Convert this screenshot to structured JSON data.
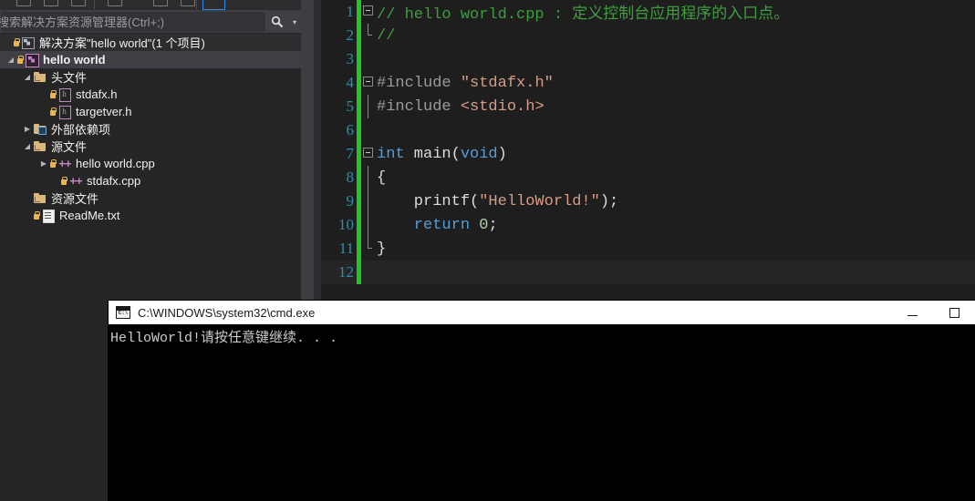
{
  "solution_explorer": {
    "search": {
      "placeholder": "搜索解决方案资源管理器(Ctrl+;)",
      "icon": "search-icon",
      "caret": "▾"
    },
    "toolbar": {
      "separator": "",
      "active_button": ""
    },
    "tree": [
      {
        "label": "解决方案\"hello world\"(1 个项目)",
        "indent": 2,
        "twisty": "",
        "icon": "solution-icon",
        "lock": true,
        "bold": false,
        "selected": false,
        "solution_row": true
      },
      {
        "label": "hello world",
        "indent": 6,
        "twisty": "▲",
        "icon": "project-icon",
        "lock": true,
        "bold": true,
        "selected": true,
        "solution_row": false
      },
      {
        "label": "头文件",
        "indent": 24,
        "twisty": "▲",
        "icon": "folder-icon",
        "lock": false,
        "bold": false,
        "selected": false,
        "solution_row": false
      },
      {
        "label": "stdafx.h",
        "indent": 42,
        "twisty": "",
        "icon": "header-file-icon",
        "lock": true,
        "bold": false,
        "selected": false,
        "solution_row": false
      },
      {
        "label": "targetver.h",
        "indent": 42,
        "twisty": "",
        "icon": "header-file-icon",
        "lock": true,
        "bold": false,
        "selected": false,
        "solution_row": false
      },
      {
        "label": "外部依赖项",
        "indent": 24,
        "twisty": "▶",
        "icon": "folder-box-icon",
        "lock": false,
        "bold": false,
        "selected": false,
        "solution_row": false
      },
      {
        "label": "源文件",
        "indent": 24,
        "twisty": "▲",
        "icon": "folder-icon",
        "lock": false,
        "bold": false,
        "selected": false,
        "solution_row": false
      },
      {
        "label": "hello world.cpp",
        "indent": 42,
        "twisty": "▶",
        "icon": "cpp-file-icon",
        "lock": true,
        "bold": false,
        "selected": false,
        "solution_row": false
      },
      {
        "label": "stdafx.cpp",
        "indent": 54,
        "twisty": "",
        "icon": "cpp-file-icon",
        "lock": true,
        "bold": false,
        "selected": false,
        "solution_row": false
      },
      {
        "label": "资源文件",
        "indent": 24,
        "twisty": "",
        "icon": "folder-icon",
        "lock": false,
        "bold": false,
        "selected": false,
        "solution_row": false
      },
      {
        "label": "ReadMe.txt",
        "indent": 24,
        "twisty": "",
        "icon": "text-file-icon",
        "lock": true,
        "bold": false,
        "selected": false,
        "solution_row": false
      }
    ]
  },
  "editor": {
    "lines": [
      {
        "num": "1",
        "outline": "box",
        "current": false,
        "tokens": [
          {
            "t": "comment",
            "v": "// hello world.cpp : 定义控制台应用程序的入口点。"
          }
        ]
      },
      {
        "num": "2",
        "outline": "end",
        "current": false,
        "tokens": [
          {
            "t": "comment",
            "v": "//"
          }
        ]
      },
      {
        "num": "3",
        "outline": "none",
        "current": false,
        "tokens": []
      },
      {
        "num": "4",
        "outline": "box",
        "current": false,
        "tokens": [
          {
            "t": "pre",
            "v": "#include "
          },
          {
            "t": "str",
            "v": "\"stdafx.h\""
          }
        ]
      },
      {
        "num": "5",
        "outline": "line",
        "current": false,
        "tokens": [
          {
            "t": "pre",
            "v": "#include "
          },
          {
            "t": "str",
            "v": "<stdio.h>"
          }
        ]
      },
      {
        "num": "6",
        "outline": "end-top",
        "current": false,
        "tokens": []
      },
      {
        "num": "7",
        "outline": "box",
        "current": false,
        "tokens": [
          {
            "t": "kw",
            "v": "int"
          },
          {
            "t": "plain",
            "v": " main("
          },
          {
            "t": "kw",
            "v": "void"
          },
          {
            "t": "plain",
            "v": ")"
          }
        ]
      },
      {
        "num": "8",
        "outline": "line",
        "current": false,
        "tokens": [
          {
            "t": "plain",
            "v": "{"
          }
        ]
      },
      {
        "num": "9",
        "outline": "line",
        "current": false,
        "tokens": [
          {
            "t": "plain",
            "v": "    printf("
          },
          {
            "t": "str",
            "v": "\"HelloWorld!\""
          },
          {
            "t": "plain",
            "v": ");"
          }
        ]
      },
      {
        "num": "10",
        "outline": "line",
        "current": false,
        "tokens": [
          {
            "t": "kw",
            "v": "    return"
          },
          {
            "t": "plain",
            "v": " "
          },
          {
            "t": "num",
            "v": "0"
          },
          {
            "t": "plain",
            "v": ";"
          }
        ]
      },
      {
        "num": "11",
        "outline": "end",
        "current": false,
        "tokens": [
          {
            "t": "plain",
            "v": "}"
          }
        ]
      },
      {
        "num": "12",
        "outline": "none",
        "current": true,
        "tokens": []
      }
    ]
  },
  "console": {
    "title": "C:\\WINDOWS\\system32\\cmd.exe",
    "icon_glyph": "C:\\",
    "minimize_label": "",
    "maximize_label": "",
    "output_lines": [
      "HelloWorld!请按任意键继续. . ."
    ]
  },
  "colors": {
    "panel_bg": "#252526",
    "editor_bg": "#1e1e1e",
    "selection": "#3f3f46",
    "change_bar": "#23c723",
    "line_number": "#2b91af",
    "comment_green": "#3e9e3e",
    "string_orange": "#d69d85",
    "keyword_blue": "#569cd6",
    "project_magenta": "#c586c0",
    "folder_orange": "#dcb67a",
    "console_bg": "#000000",
    "console_text": "#cccccc"
  }
}
